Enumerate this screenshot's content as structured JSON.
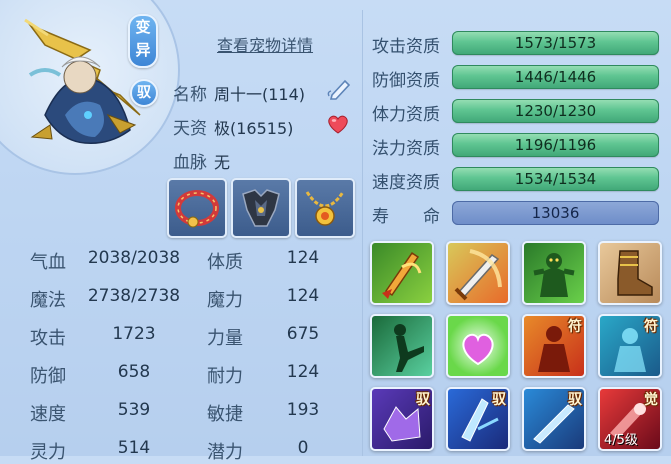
{
  "pet": {
    "mutation_badge": "变异",
    "ride_badge": "驭",
    "details_link": "查看宠物详情",
    "name_label": "名称",
    "name_value": "周十一(114)",
    "talent_label": "天资",
    "talent_value": "极(16515)",
    "bloodline_label": "血脉",
    "bloodline_value": "无"
  },
  "stats": {
    "rows": [
      {
        "l_label": "气血",
        "l_value": "2038/2038",
        "r_label": "体质",
        "r_value": "124"
      },
      {
        "l_label": "魔法",
        "l_value": "2738/2738",
        "r_label": "魔力",
        "r_value": "124"
      },
      {
        "l_label": "攻击",
        "l_value": "1723",
        "r_label": "力量",
        "r_value": "675"
      },
      {
        "l_label": "防御",
        "l_value": "658",
        "r_label": "耐力",
        "r_value": "124"
      },
      {
        "l_label": "速度",
        "l_value": "539",
        "r_label": "敏捷",
        "r_value": "193"
      },
      {
        "l_label": "灵力",
        "l_value": "514",
        "r_label": "潜力",
        "r_value": "0"
      }
    ]
  },
  "aptitudes": [
    {
      "label": "攻击资质",
      "value": "1573/1573",
      "fraction": 1.0
    },
    {
      "label": "防御资质",
      "value": "1446/1446",
      "fraction": 1.0
    },
    {
      "label": "体力资质",
      "value": "1230/1230",
      "fraction": 1.0
    },
    {
      "label": "法力资质",
      "value": "1196/1196",
      "fraction": 1.0
    },
    {
      "label": "速度资质",
      "value": "1534/1534",
      "fraction": 1.0
    }
  ],
  "life": {
    "label": "寿　　命",
    "value": "13036"
  },
  "skills": {
    "tag_fu": "符",
    "tag_yu": "驭",
    "tag_jue": "觉",
    "awaken_level": "4/5级"
  },
  "colors": {
    "aptitude_bar": "#5fc592",
    "life_bar": "#6d8cc8",
    "text_dark": "#23384f",
    "label": "#3a5470"
  }
}
